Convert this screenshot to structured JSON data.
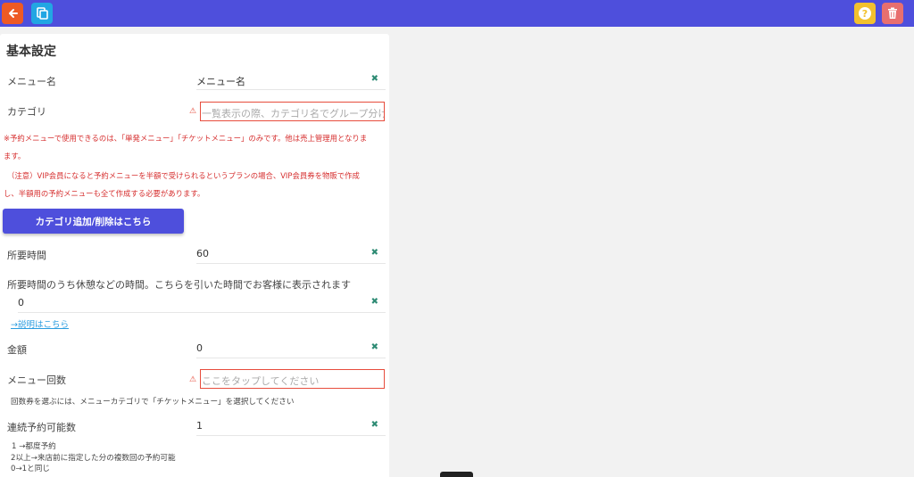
{
  "header": {
    "back_icon": "arrow-left-icon",
    "copy_icon": "copy-icon",
    "help_icon": "question-icon",
    "help_glyph": "?",
    "trash_icon": "trash-icon"
  },
  "section_title": "基本設定",
  "menu_name": {
    "label": "メニュー名",
    "value": "メニュー名"
  },
  "category": {
    "label": "カテゴリ",
    "placeholder": "一覧表示の際、カテゴリ名でグループ分け"
  },
  "notes": {
    "line1": "※予約メニューで使用できるのは、「単発メニュー」「チケットメニュー」のみです。他は売上管理用となりま",
    "line2": "ます。",
    "line3": "（注意）VIP会員になると予約メニューを半額で受けられるというプランの場合、VIP会員券を物販で作成",
    "line4": "し、半額用の予約メニューも全て作成する必要があります。"
  },
  "category_button": "カテゴリ追加/削除はこちら",
  "duration": {
    "label": "所要時間",
    "value": "60"
  },
  "break_time": {
    "label": "所要時間のうち休憩などの時間。こちらを引いた時間でお客様に表示されます",
    "value": "0"
  },
  "explain_link": "→説明はこちら",
  "price": {
    "label": "金額",
    "value": "0"
  },
  "menu_count": {
    "label": "メニュー回数",
    "placeholder": "ここをタップしてください"
  },
  "menu_count_note": "回数券を選ぶには、メニューカテゴリで「チケットメニュー」を選択してください",
  "consecutive": {
    "label": "連続予約可能数",
    "value": "1"
  },
  "consecutive_notes": {
    "line1": "1 →都度予約",
    "line2": "2以上→来店前に指定した分の複数回の予約可能",
    "line3": "0→1と同じ"
  },
  "clear_glyph": "✖",
  "warn_glyph": "⚠"
}
